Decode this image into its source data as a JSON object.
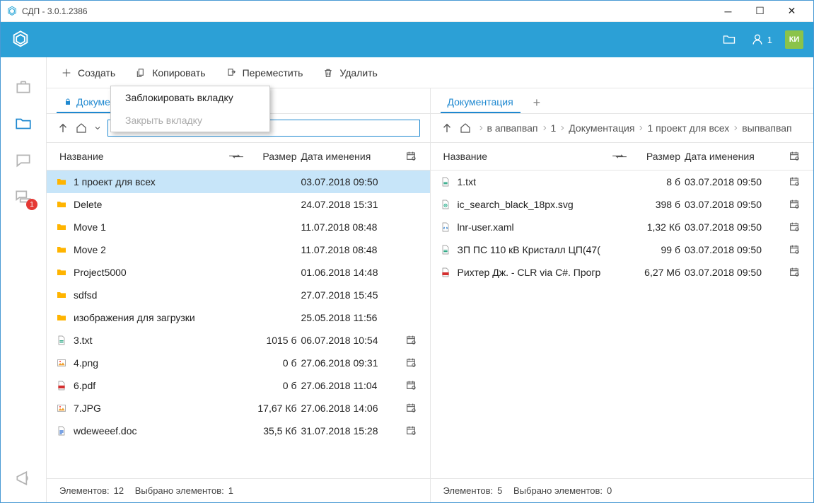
{
  "app_title": "СДП - 3.0.1.2386",
  "header": {
    "user_count": "1",
    "user_initials": "КИ"
  },
  "rail": {
    "chat_badge": "1"
  },
  "toolbar": {
    "create": "Создать",
    "copy": "Копировать",
    "move": "Переместить",
    "delete": "Удалить"
  },
  "context_menu": {
    "lock": "Заблокировать вкладку",
    "close": "Закрыть вкладку"
  },
  "left": {
    "tab": "Документация",
    "columns": {
      "name": "Название",
      "size": "Размер",
      "date": "Дата именения"
    },
    "rows": [
      {
        "type": "folder",
        "name": "1 проект для всех",
        "size": "",
        "date": "03.07.2018 09:50",
        "cal": false,
        "selected": true
      },
      {
        "type": "folder",
        "name": "Delete",
        "size": "",
        "date": "24.07.2018 15:31",
        "cal": false
      },
      {
        "type": "folder",
        "name": "Move 1",
        "size": "",
        "date": "11.07.2018 08:48",
        "cal": false
      },
      {
        "type": "folder",
        "name": "Move 2",
        "size": "",
        "date": "11.07.2018 08:48",
        "cal": false
      },
      {
        "type": "folder",
        "name": "Project5000",
        "size": "",
        "date": "01.06.2018 14:48",
        "cal": false
      },
      {
        "type": "folder",
        "name": "sdfsd",
        "size": "",
        "date": "27.07.2018 15:45",
        "cal": false
      },
      {
        "type": "folder",
        "name": "изображения для загрузки",
        "size": "",
        "date": "25.05.2018 11:56",
        "cal": false
      },
      {
        "type": "txt",
        "name": "3.txt",
        "size": "1015 б",
        "date": "06.07.2018 10:54",
        "cal": true
      },
      {
        "type": "png",
        "name": "4.png",
        "size": "0 б",
        "date": "27.06.2018 09:31",
        "cal": true
      },
      {
        "type": "pdf",
        "name": "6.pdf",
        "size": "0 б",
        "date": "27.06.2018 11:04",
        "cal": true
      },
      {
        "type": "jpg",
        "name": "7.JPG",
        "size": "17,67 Кб",
        "date": "27.06.2018 14:06",
        "cal": true
      },
      {
        "type": "doc",
        "name": "wdeweeef.doc",
        "size": "35,5 Кб",
        "date": "31.07.2018 15:28",
        "cal": true
      }
    ],
    "status": {
      "count_label": "Элементов:",
      "count": "12",
      "sel_label": "Выбрано элементов:",
      "sel": "1"
    }
  },
  "right": {
    "tab": "Документация",
    "crumbs": [
      "в апвапвап",
      "1",
      "Документация",
      "1 проект для всех",
      "выпвапвап"
    ],
    "columns": {
      "name": "Название",
      "size": "Размер",
      "date": "Дата именения"
    },
    "rows": [
      {
        "type": "txt",
        "name": "1.txt",
        "size": "8 б",
        "date": "03.07.2018 09:50",
        "cal": true
      },
      {
        "type": "svg",
        "name": "ic_search_black_18px.svg",
        "size": "398 б",
        "date": "03.07.2018 09:50",
        "cal": true
      },
      {
        "type": "xaml",
        "name": "lnr-user.xaml",
        "size": "1,32 Кб",
        "date": "03.07.2018 09:50",
        "cal": true
      },
      {
        "type": "txt",
        "name": "ЗП ПС 110 кВ Кристалл ЦП(47(",
        "size": "99 б",
        "date": "03.07.2018 09:50",
        "cal": true
      },
      {
        "type": "pdf",
        "name": "Рихтер Дж. - CLR via C#. Прогр",
        "size": "6,27 Мб",
        "date": "03.07.2018 09:50",
        "cal": true
      }
    ],
    "status": {
      "count_label": "Элементов:",
      "count": "5",
      "sel_label": "Выбрано элементов:",
      "sel": "0"
    }
  }
}
